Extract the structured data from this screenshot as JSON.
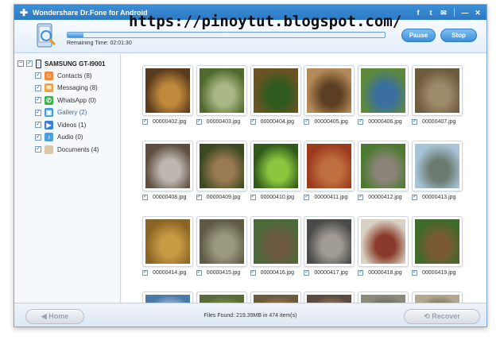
{
  "window": {
    "title": "Wondershare Dr.Fone for Android",
    "watermark": "https://pinoytut.blogspot.com/",
    "title_icons": [
      "facebook-icon",
      "twitter-icon",
      "feedback-icon",
      "minimize-icon",
      "close-icon"
    ],
    "title_glyphs": [
      "f",
      "t",
      "✉",
      "—",
      "✕"
    ]
  },
  "header": {
    "progress_percent_label": "5%",
    "progress_fraction": 0.05,
    "remaining_time": "Remaining Time: 02:01:30",
    "pause_label": "Pause",
    "stop_label": "Stop"
  },
  "sidebar": {
    "device": "SAMSUNG GT-I9001",
    "items": [
      {
        "label": "Contacts (8)",
        "icon": "contacts-icon",
        "color": "#f08a3c",
        "glyph": "☺",
        "selected": false
      },
      {
        "label": "Messaging (8)",
        "icon": "messaging-icon",
        "color": "#f0a040",
        "glyph": "✉",
        "selected": false
      },
      {
        "label": "WhatsApp (0)",
        "icon": "whatsapp-icon",
        "color": "#3bb54a",
        "glyph": "✆",
        "selected": false
      },
      {
        "label": "Gallery (2)",
        "icon": "gallery-icon",
        "color": "#3d9be0",
        "glyph": "▣",
        "selected": true
      },
      {
        "label": "Videos (1)",
        "icon": "videos-icon",
        "color": "#3d7fd6",
        "glyph": "▶",
        "selected": false
      },
      {
        "label": "Audio (0)",
        "icon": "audio-icon",
        "color": "#4aa0e0",
        "glyph": "♪",
        "selected": false
      },
      {
        "label": "Documents (4)",
        "icon": "documents-icon",
        "color": "#d9c9a8",
        "glyph": "",
        "selected": false
      }
    ]
  },
  "gallery": {
    "items": [
      {
        "name": "00000402.jpg",
        "bg": "#5a3a1c",
        "fg": "#c08a3c"
      },
      {
        "name": "00000403.jpg",
        "bg": "#4f6a2c",
        "fg": "#a9b784"
      },
      {
        "name": "00000404.jpg",
        "bg": "#6a5424",
        "fg": "#2e5a1e"
      },
      {
        "name": "00000405.jpg",
        "bg": "#b48a58",
        "fg": "#5c3e22"
      },
      {
        "name": "00000406.jpg",
        "bg": "#5d8a3a",
        "fg": "#3a6fa0"
      },
      {
        "name": "00000407.jpg",
        "bg": "#6e5a3c",
        "fg": "#9d8a68"
      },
      {
        "name": "00000408.jpg",
        "bg": "#5e4e40",
        "fg": "#bdb7b0"
      },
      {
        "name": "00000409.jpg",
        "bg": "#3c4a22",
        "fg": "#9a7a52"
      },
      {
        "name": "00000410.jpg",
        "bg": "#2f5a1a",
        "fg": "#8cc63e"
      },
      {
        "name": "00000411.jpg",
        "bg": "#9c3a1e",
        "fg": "#c07040"
      },
      {
        "name": "00000412.jpg",
        "bg": "#4d7a30",
        "fg": "#8b8478"
      },
      {
        "name": "00000413.jpg",
        "bg": "#a7c4d8",
        "fg": "#6c7a70"
      },
      {
        "name": "00000414.jpg",
        "bg": "#8a6424",
        "fg": "#c89a44"
      },
      {
        "name": "00000415.jpg",
        "bg": "#5e5a44",
        "fg": "#9a9a80"
      },
      {
        "name": "00000416.jpg",
        "bg": "#4a6a3a",
        "fg": "#6c5a40"
      },
      {
        "name": "00000417.jpg",
        "bg": "#4a4a48",
        "fg": "#a09c94"
      },
      {
        "name": "00000418.jpg",
        "bg": "#d8d2c4",
        "fg": "#8a3a2a"
      },
      {
        "name": "00000419.jpg",
        "bg": "#3e6a2a",
        "fg": "#7a5a34"
      },
      {
        "name": "",
        "bg": "#4a7aa8",
        "fg": "#cdd8e2"
      },
      {
        "name": "",
        "bg": "#5a6a3a",
        "fg": "#8a9a5a"
      },
      {
        "name": "",
        "bg": "#6a5a3e",
        "fg": "#a08a60"
      },
      {
        "name": "",
        "bg": "#5a4a40",
        "fg": "#b09070"
      },
      {
        "name": "",
        "bg": "#8a8a7a",
        "fg": "#5a5a4a"
      },
      {
        "name": "",
        "bg": "#b0a890",
        "fg": "#5a5040"
      }
    ]
  },
  "footer": {
    "home_label": "Home",
    "recover_label": "Recover",
    "files_found": "Files Found: 219.39MB in 474 item(s)"
  }
}
